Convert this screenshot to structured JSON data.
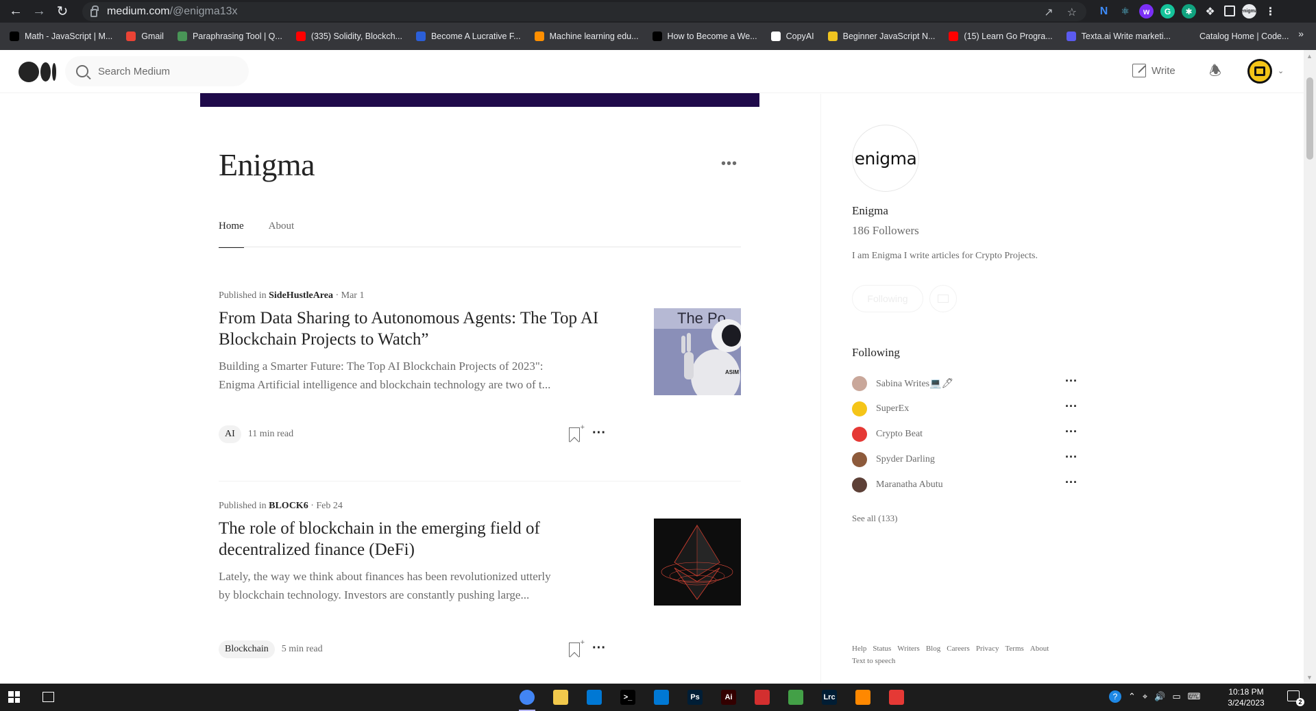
{
  "browser": {
    "url_host": "medium.com",
    "url_path": "/@enigma13x",
    "bookmarks": [
      {
        "label": "Math - JavaScript | M...",
        "icon": "medium-icon",
        "color": "#000000"
      },
      {
        "label": "Gmail",
        "icon": "gmail-icon",
        "color": "#ea4335"
      },
      {
        "label": "Paraphrasing Tool | Q...",
        "icon": "quillbot-icon",
        "color": "#499557"
      },
      {
        "label": "(335) Solidity, Blockch...",
        "icon": "youtube-icon",
        "color": "#ff0000"
      },
      {
        "label": "Become A Lucrative F...",
        "icon": "moon-icon",
        "color": "#2b5fd9"
      },
      {
        "label": "Machine learning edu...",
        "icon": "tensorflow-icon",
        "color": "#ff8f00"
      },
      {
        "label": "How to Become a We...",
        "icon": "medium-icon",
        "color": "#000000"
      },
      {
        "label": "CopyAI",
        "icon": "copyai-icon",
        "color": "#ffffff"
      },
      {
        "label": "Beginner JavaScript N...",
        "icon": "crown-icon",
        "color": "#f0c420"
      },
      {
        "label": "(15) Learn Go Progra...",
        "icon": "youtube-icon",
        "color": "#ff0000"
      },
      {
        "label": "Texta.ai Write marketi...",
        "icon": "texta-icon",
        "color": "#5b5bf0"
      },
      {
        "label": "Catalog Home | Code...",
        "icon": "codecademy-icon",
        "color": "#35363a"
      }
    ],
    "bookmarks_more": "»"
  },
  "header": {
    "search_placeholder": "Search Medium",
    "write_label": "Write"
  },
  "publication": {
    "title": "Enigma",
    "tabs": [
      "Home",
      "About"
    ]
  },
  "articles": [
    {
      "publication_prefix": "Published in ",
      "publication": "SideHustleArea",
      "date": " · Mar 1",
      "title": "From Data Sharing to Autonomous Agents: The Top AI Blockchain Projects to Watch”",
      "excerpt_line1": "Building a Smarter Future: The Top AI Blockchain Projects of 2023\":",
      "excerpt_line2": "Enigma Artificial intelligence and blockchain technology are two of t...",
      "tag": "AI",
      "read_time": "11 min read",
      "thumb_text": "The Po",
      "thumb_text2": "ASIM"
    },
    {
      "publication_prefix": "Published in ",
      "publication": "BLOCK6",
      "date": " · Feb 24",
      "title": "The role of blockchain in the emerging field of decentralized finance (DeFi)",
      "excerpt_line1": "Lately, the way we think about finances has been revolutionized utterly",
      "excerpt_line2": "by blockchain technology. Investors are constantly pushing large...",
      "tag": "Blockchain",
      "read_time": "5 min read"
    }
  ],
  "sidebar": {
    "avatar_text": "enigma",
    "name": "Enigma",
    "followers": "186 Followers",
    "bio": "I am Enigma I write articles for Crypto Projects.",
    "following_button": "Following",
    "following_heading": "Following",
    "following": [
      {
        "name": "Sabina Writes💻🖊",
        "color": "#c9a79a"
      },
      {
        "name": "SuperEx",
        "color": "#f5c518"
      },
      {
        "name": "Crypto Beat",
        "color": "#e53935"
      },
      {
        "name": "Spyder Darling",
        "color": "#8d5a3b"
      },
      {
        "name": "Maranatha Abutu",
        "color": "#5d4037"
      }
    ],
    "see_all": "See all (133)",
    "footer_links": [
      "Help",
      "Status",
      "Writers",
      "Blog",
      "Careers",
      "Privacy",
      "Terms",
      "About"
    ],
    "footer_line2": "Text to speech"
  },
  "taskbar": {
    "time": "10:18 PM",
    "date": "3/24/2023",
    "notification_count": "2",
    "apps": [
      {
        "name": "chrome-icon",
        "label": "",
        "color": "#4285f4"
      },
      {
        "name": "file-explorer-icon",
        "label": "",
        "color": "#f2c94c"
      },
      {
        "name": "store-icon",
        "label": "",
        "color": "#0078d4"
      },
      {
        "name": "terminal-icon",
        "label": ">_",
        "color": "#000000"
      },
      {
        "name": "vscode-icon",
        "label": "",
        "color": "#0078d4"
      },
      {
        "name": "photoshop-icon",
        "label": "Ps",
        "color": "#001e36"
      },
      {
        "name": "illustrator-icon",
        "label": "Ai",
        "color": "#330000"
      },
      {
        "name": "app-red-icon",
        "label": "",
        "color": "#d32f2f"
      },
      {
        "name": "node-icon",
        "label": "",
        "color": "#43a047"
      },
      {
        "name": "lightroom-icon",
        "label": "Lrc",
        "color": "#001d34"
      },
      {
        "name": "vlc-icon",
        "label": "",
        "color": "#ff8800"
      },
      {
        "name": "snipping-icon",
        "label": "",
        "color": "#e53935"
      }
    ]
  },
  "colors": {
    "banner": "#1f0a4a",
    "text_primary": "#242424",
    "text_secondary": "#6b6b6b"
  }
}
